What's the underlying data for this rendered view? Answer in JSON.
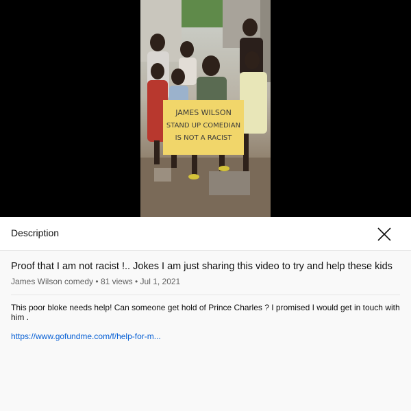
{
  "video": {
    "sign_text": [
      "JAMES WILSON",
      "STAND UP COMEDIAN",
      "IS NOT A RACIST"
    ]
  },
  "panel": {
    "header_title": "Description",
    "close_icon": "close-icon",
    "video_title": "Proof that I am not racist !.. Jokes I am just sharing this video to try and help these kids",
    "channel": "James Wilson comedy",
    "views": "81 views",
    "date": "Jul 1, 2021",
    "meta_separator": "•",
    "description": "This poor bloke needs help!  Can someone get hold of Prince Charles ? I promised I would get in touch with him .",
    "link_text": "https://www.gofundme.com/f/help-for-m..."
  },
  "colors": {
    "link": "#065fd4",
    "meta_text": "#606060",
    "background": "#f9f9f9"
  }
}
